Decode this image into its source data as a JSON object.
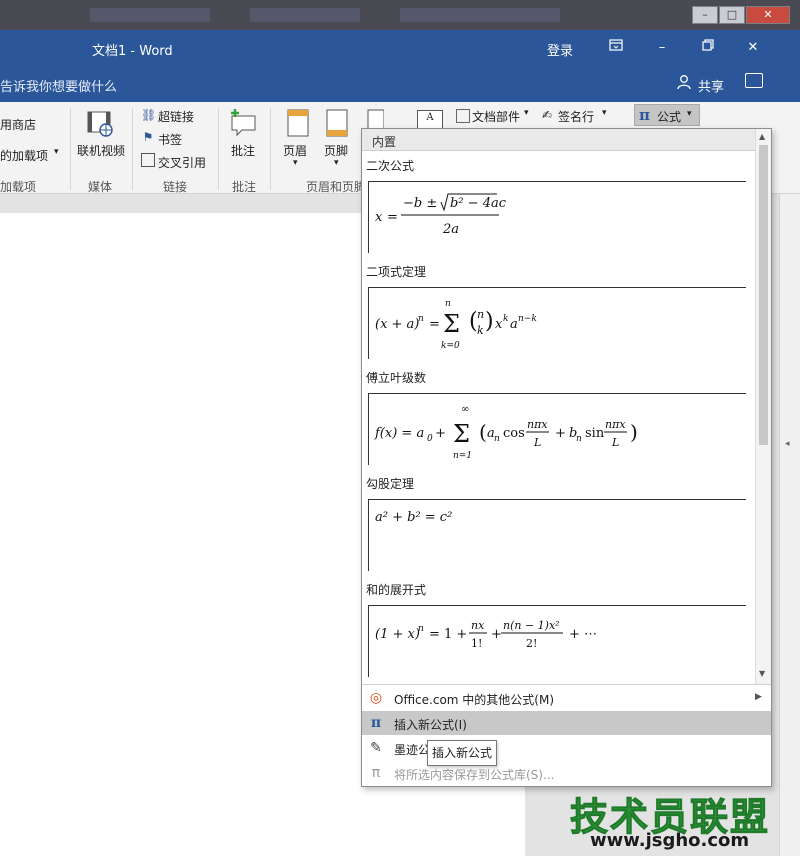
{
  "window": {
    "title": "文档1  -  Word",
    "signin_label": "登录",
    "tellme_placeholder": "告诉我你想要做什么",
    "share_label": "共享"
  },
  "ribbon": {
    "addins": {
      "store_label": "用商店",
      "my_addins_label": "的加载项",
      "group_label": "加载项"
    },
    "media": {
      "online_video_label": "联机视频",
      "group_label": "媒体"
    },
    "links": {
      "hyperlink_label": "超链接",
      "bookmark_label": "书签",
      "crossref_label": "交叉引用",
      "group_label": "链接"
    },
    "comments": {
      "comment_label": "批注",
      "group_label": "批注"
    },
    "header_footer": {
      "header_label": "页眉",
      "footer_label": "页脚",
      "group_label": "页眉和页脚"
    },
    "text": {
      "quick_parts_label": "文档部件",
      "signature_label": "签名行"
    },
    "symbols": {
      "equation_label": "公式"
    }
  },
  "gallery": {
    "header": "内置",
    "equations": [
      {
        "title": "二次公式",
        "formula": "x = (−b ± √(b² − 4ac)) / 2a"
      },
      {
        "title": "二项式定理",
        "formula": "(x + a)ⁿ = Σₖ₌₀ⁿ (n k) xᵏ aⁿ⁻ᵏ"
      },
      {
        "title": "傅立叶级数",
        "formula": "f(x) = a₀ + Σₙ₌₁^∞ (aₙ cos nπx/L + bₙ sin nπx/L)"
      },
      {
        "title": "勾股定理",
        "formula": "a² + b² = c²"
      },
      {
        "title": "和的展开式",
        "formula": "(1 + x)ⁿ = 1 + nx/1! + n(n − 1)x²/2! + ⋯"
      }
    ],
    "menu": {
      "office_more": "Office.com 中的其他公式(M)",
      "insert_new": "插入新公式(I)",
      "ink_equation": "墨迹公",
      "save_selection": "将所选内容保存到公式库(S)..."
    },
    "tooltip": "插入新公式"
  },
  "watermark": {
    "brand": "技术员联盟",
    "url": "www.jsgho.com"
  },
  "colors": {
    "title_bar": "#2b579a",
    "watermark_green": "#2fa33a"
  }
}
